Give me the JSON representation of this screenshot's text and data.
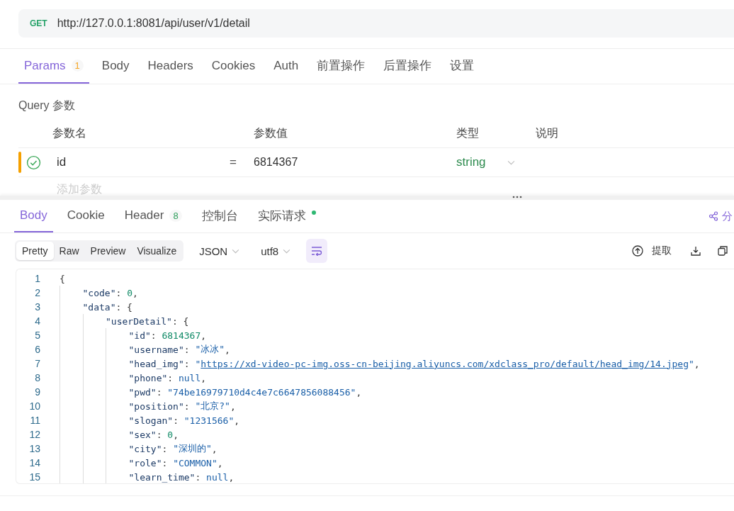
{
  "request": {
    "method": "GET",
    "url": "http://127.0.0.1:8081/api/user/v1/detail"
  },
  "request_tabs": [
    {
      "label": "Params",
      "badge": "1",
      "color": "#f5a623",
      "selected": true
    },
    {
      "label": "Body",
      "selected": false
    },
    {
      "label": "Headers",
      "selected": false
    },
    {
      "label": "Cookies",
      "selected": false
    },
    {
      "label": "Auth",
      "selected": false
    },
    {
      "label": "前置操作",
      "selected": false
    },
    {
      "label": "后置操作",
      "selected": false
    },
    {
      "label": "设置",
      "selected": false
    }
  ],
  "query": {
    "title": "Query 参数",
    "columns": [
      "参数名",
      "参数值",
      "类型",
      "说明"
    ],
    "rows": [
      {
        "enabled": true,
        "name": "id",
        "operator": "=",
        "value": "6814367",
        "type": "string"
      }
    ],
    "add_placeholder": "添加参数"
  },
  "response_tabs": [
    {
      "label": "Body",
      "selected": true
    },
    {
      "label": "Cookie",
      "selected": false
    },
    {
      "label": "Header",
      "badge": "8",
      "color": "#2e9e5b",
      "selected": false
    },
    {
      "label": "控制台",
      "selected": false
    },
    {
      "label": "实际请求",
      "dot": true,
      "selected": false
    }
  ],
  "share": {
    "label": "分"
  },
  "view_modes": [
    {
      "label": "Pretty",
      "selected": true
    },
    {
      "label": "Raw",
      "selected": false
    },
    {
      "label": "Preview",
      "selected": false
    },
    {
      "label": "Visualize",
      "selected": false
    }
  ],
  "format": "JSON",
  "encoding": "utf8",
  "wrap": {
    "on": true
  },
  "extract": {
    "label": "提取"
  },
  "code": {
    "lines": [
      {
        "number": "1",
        "tokens": [
          {
            "kind": "punct",
            "text": "{"
          }
        ]
      },
      {
        "number": "2",
        "tokens": [
          {
            "kind": "key",
            "text": "    \"code\""
          },
          {
            "kind": "punct",
            "text": ": "
          },
          {
            "kind": "num",
            "text": "0"
          },
          {
            "kind": "punct",
            "text": ","
          }
        ]
      },
      {
        "number": "3",
        "tokens": [
          {
            "kind": "key",
            "text": "    \"data\""
          },
          {
            "kind": "punct",
            "text": ": {"
          }
        ]
      },
      {
        "number": "4",
        "tokens": [
          {
            "kind": "key",
            "text": "        \"userDetail\""
          },
          {
            "kind": "punct",
            "text": ": {"
          }
        ]
      },
      {
        "number": "5",
        "tokens": [
          {
            "kind": "key",
            "text": "            \"id\""
          },
          {
            "kind": "punct",
            "text": ": "
          },
          {
            "kind": "num",
            "text": "6814367"
          },
          {
            "kind": "punct",
            "text": ","
          }
        ]
      },
      {
        "number": "6",
        "tokens": [
          {
            "kind": "key",
            "text": "            \"username\""
          },
          {
            "kind": "punct",
            "text": ": "
          },
          {
            "kind": "str",
            "text": "\"冰冰\""
          },
          {
            "kind": "punct",
            "text": ","
          }
        ]
      },
      {
        "number": "7",
        "tokens": [
          {
            "kind": "key",
            "text": "            \"head_img\""
          },
          {
            "kind": "punct",
            "text": ": "
          },
          {
            "kind": "str",
            "text": "\""
          },
          {
            "kind": "link",
            "text": "https://xd-video-pc-img.oss-cn-beijing.aliyuncs.com/xdclass_pro/default/head_img/14.jpeg"
          },
          {
            "kind": "str",
            "text": "\""
          },
          {
            "kind": "punct",
            "text": ","
          }
        ]
      },
      {
        "number": "8",
        "tokens": [
          {
            "kind": "key",
            "text": "            \"phone\""
          },
          {
            "kind": "punct",
            "text": ": "
          },
          {
            "kind": "null",
            "text": "null"
          },
          {
            "kind": "punct",
            "text": ","
          }
        ]
      },
      {
        "number": "9",
        "tokens": [
          {
            "kind": "key",
            "text": "            \"pwd\""
          },
          {
            "kind": "punct",
            "text": ": "
          },
          {
            "kind": "str",
            "text": "\"74be16979710d4c4e7c6647856088456\""
          },
          {
            "kind": "punct",
            "text": ","
          }
        ]
      },
      {
        "number": "10",
        "tokens": [
          {
            "kind": "key",
            "text": "            \"position\""
          },
          {
            "kind": "punct",
            "text": ": "
          },
          {
            "kind": "str",
            "text": "\"北京?\""
          },
          {
            "kind": "punct",
            "text": ","
          }
        ]
      },
      {
        "number": "11",
        "tokens": [
          {
            "kind": "key",
            "text": "            \"slogan\""
          },
          {
            "kind": "punct",
            "text": ": "
          },
          {
            "kind": "str",
            "text": "\"1231566\""
          },
          {
            "kind": "punct",
            "text": ","
          }
        ]
      },
      {
        "number": "12",
        "tokens": [
          {
            "kind": "key",
            "text": "            \"sex\""
          },
          {
            "kind": "punct",
            "text": ": "
          },
          {
            "kind": "num",
            "text": "0"
          },
          {
            "kind": "punct",
            "text": ","
          }
        ]
      },
      {
        "number": "13",
        "tokens": [
          {
            "kind": "key",
            "text": "            \"city\""
          },
          {
            "kind": "punct",
            "text": ": "
          },
          {
            "kind": "str",
            "text": "\"深圳的\""
          },
          {
            "kind": "punct",
            "text": ","
          }
        ]
      },
      {
        "number": "14",
        "tokens": [
          {
            "kind": "key",
            "text": "            \"role\""
          },
          {
            "kind": "punct",
            "text": ": "
          },
          {
            "kind": "str",
            "text": "\"COMMON\""
          },
          {
            "kind": "punct",
            "text": ","
          }
        ]
      },
      {
        "number": "15",
        "tokens": [
          {
            "kind": "key",
            "text": "            \"learn_time\""
          },
          {
            "kind": "punct",
            "text": ": "
          },
          {
            "kind": "null",
            "text": "null"
          },
          {
            "kind": "punct",
            "text": ","
          }
        ]
      }
    ]
  }
}
